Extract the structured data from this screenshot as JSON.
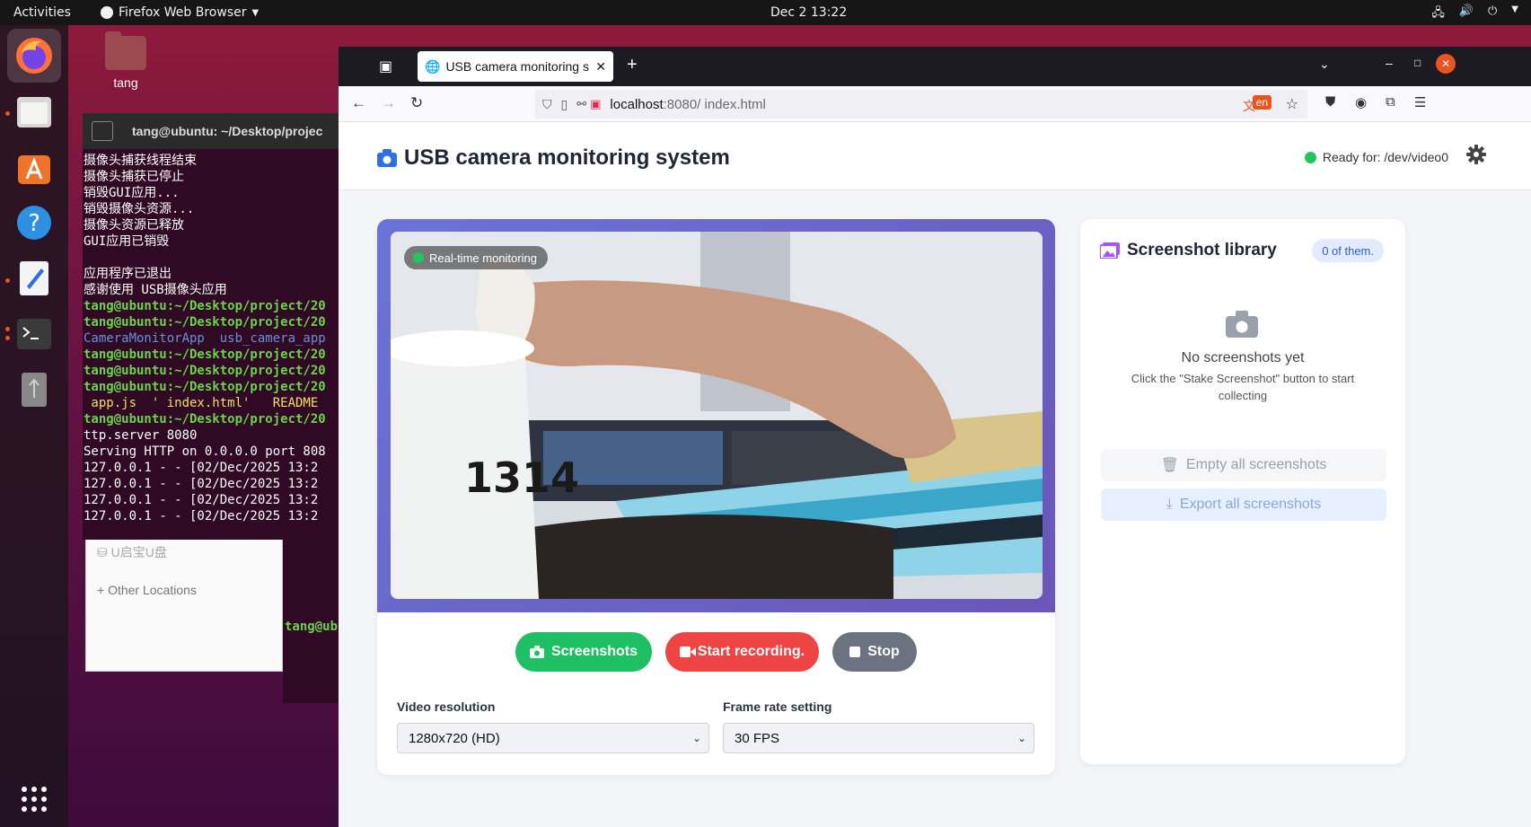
{
  "topbar": {
    "activities": "Activities",
    "app_name": "Firefox Web Browser",
    "clock": "Dec 2  13:22"
  },
  "desktop": {
    "folder_label": "tang"
  },
  "terminal": {
    "title": "tang@ubuntu: ~/Desktop/projec",
    "lines": [
      {
        "cls": "",
        "text": "摄像头捕获线程结束"
      },
      {
        "cls": "",
        "text": "摄像头捕获已停止"
      },
      {
        "cls": "",
        "text": "销毁GUI应用..."
      },
      {
        "cls": "",
        "text": "销毁摄像头资源..."
      },
      {
        "cls": "",
        "text": "摄像头资源已释放"
      },
      {
        "cls": "",
        "text": "GUI应用已销毁"
      },
      {
        "cls": "",
        "text": " "
      },
      {
        "cls": "",
        "text": "应用程序已退出"
      },
      {
        "cls": "",
        "text": "感谢使用 USB摄像头应用"
      },
      {
        "cls": "g",
        "text": "tang@ubuntu:~/Desktop/project/20"
      },
      {
        "cls": "g",
        "text": "tang@ubuntu:~/Desktop/project/20"
      },
      {
        "cls": "b",
        "text": "CameraMonitorApp  usb_camera_app"
      },
      {
        "cls": "g",
        "text": "tang@ubuntu:~/Desktop/project/20"
      },
      {
        "cls": "g",
        "text": "tang@ubuntu:~/Desktop/project/20"
      },
      {
        "cls": "g",
        "text": "tang@ubuntu:~/Desktop/project/20"
      },
      {
        "cls": "y",
        "text": " app.js  ' index.html'   README"
      },
      {
        "cls": "g",
        "text": "tang@ubuntu:~/Desktop/project/20"
      },
      {
        "cls": "",
        "text": "ttp.server 8080"
      },
      {
        "cls": "",
        "text": "Serving HTTP on 0.0.0.0 port 808"
      },
      {
        "cls": "",
        "text": "127.0.0.1 - - [02/Dec/2025 13:2"
      },
      {
        "cls": "",
        "text": "127.0.0.1 - - [02/Dec/2025 13:2"
      },
      {
        "cls": "",
        "text": "127.0.0.1 - - [02/Dec/2025 13:2"
      },
      {
        "cls": "",
        "text": "127.0.0.1 - - [02/Dec/2025 13:2"
      }
    ],
    "second_prompt": "tang@ub"
  },
  "files": {
    "drive": "U启宝U盘",
    "other_locations": "Other Locations"
  },
  "browser": {
    "tab_title": "USB camera monitoring s",
    "url_host": "localhost",
    "url_rest": ":8080/ index.html",
    "translate_badge": "en"
  },
  "app": {
    "title": "USB camera monitoring system",
    "status": "Ready for: /dev/video0",
    "live_badge": "Real-time monitoring",
    "buttons": {
      "screenshot": "Screenshots",
      "record": "Start recording.",
      "stop": "Stop"
    },
    "settings": {
      "resolution_label": "Video resolution",
      "resolution_value": "1280x720 (HD)",
      "fps_label": "Frame rate setting",
      "fps_value": "30 FPS"
    },
    "library": {
      "title": "Screenshot library",
      "count": "0 of them.",
      "empty_title": "No screenshots yet",
      "empty_desc": "Click the \"Stake Screenshot\" button to start collecting",
      "clear_label": "Empty all screenshots",
      "export_label": "Export all screenshots"
    },
    "video_mug_text": "1314",
    "colors": {
      "accent_blue": "#2f6fe0",
      "green": "#1fbf63",
      "red": "#ef4444",
      "gray": "#6b7280",
      "video_border_start": "#6a74d6",
      "video_border_end": "#6b55b9"
    }
  }
}
